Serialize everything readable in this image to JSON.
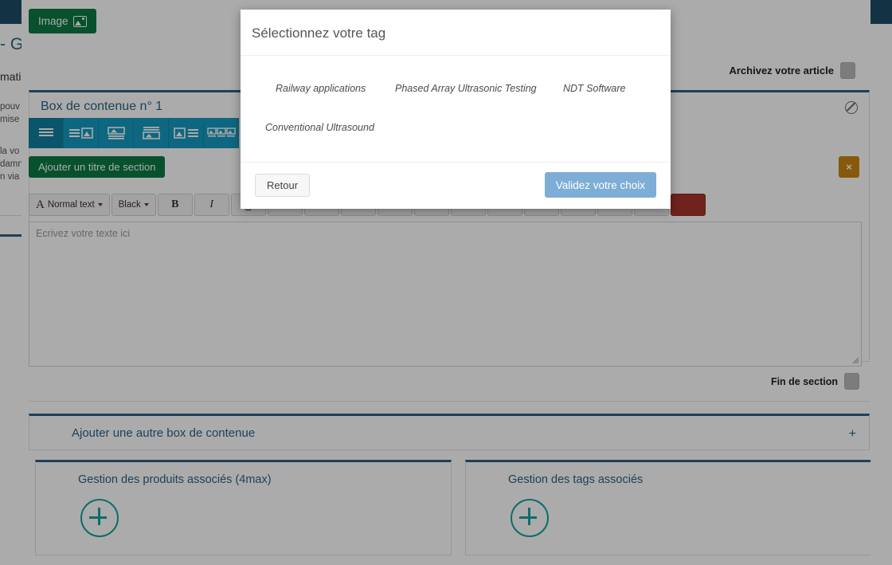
{
  "page": {
    "image_button": "Image",
    "image_button_icon": "image-icon",
    "archive_label": "Archivez votre article",
    "box_title": "Box de contenue n° 1",
    "disable_icon": "circle-slash-icon",
    "add_section_title_button": "Ajouter un titre de section",
    "remove_box_button": "×",
    "editor_placeholder": "Ecrivez votre texte ici",
    "end_of_section_label": "Fin de section",
    "add_another_box": "Ajouter une autre box de contenue",
    "add_another_box_plus": "+",
    "layout_options": [
      "layout-text-only-icon",
      "layout-text-image-right-icon",
      "layout-image-top-icon",
      "layout-image-bottom-icon",
      "layout-image-left-text-right-icon",
      "layout-three-images-icon"
    ],
    "toolbar": {
      "style_label": "Normal text",
      "color_label": "Black",
      "bold_label": "B",
      "italic_label": "I",
      "underline_label": "u",
      "align_label": "≡"
    },
    "panels": [
      {
        "title": "Gestion des produits associés (4max)",
        "add_icon": "plus-circle-icon"
      },
      {
        "title": "Gestion des tags associés",
        "add_icon": "plus-circle-icon"
      }
    ],
    "left_column": {
      "title": "- G",
      "subtitle": "mati",
      "para1_line1": "pouv",
      "para1_line2": "mise",
      "para2_line1": "la vo",
      "para2_line2": "damn",
      "para2_line3": "n via '"
    }
  },
  "modal": {
    "title": "Sélectionnez votre tag",
    "tags_row1": [
      "Railway applications",
      "Phased Array Ultrasonic Testing",
      "NDT Software"
    ],
    "tags_row2": [
      "Conventional Ultrasound"
    ],
    "back_button": "Retour",
    "validate_button": "Validez votre choix"
  },
  "colors": {
    "navy": "#1d4c66",
    "green": "#0b7a44",
    "cyan": "#149ac0",
    "teal": "#13a3a0",
    "orange": "#c8870f",
    "red": "#a8352a",
    "modal_blue": "#7eadd6"
  }
}
